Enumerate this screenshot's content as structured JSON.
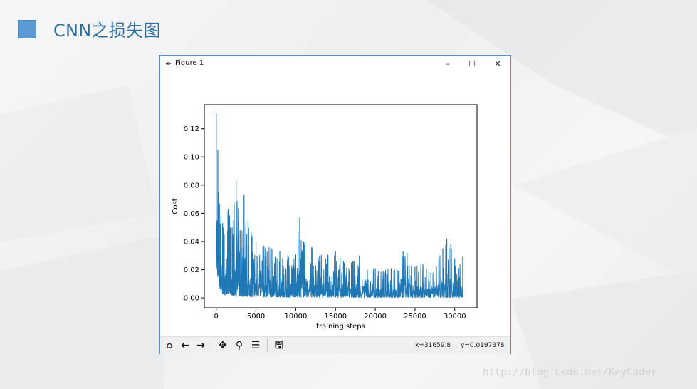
{
  "slide": {
    "title": "CNN之损失图"
  },
  "window": {
    "title": "Figure 1",
    "icon": "feather-icon",
    "controls": {
      "minimize": "–",
      "maximize": "☐",
      "close": "✕"
    }
  },
  "toolbar": {
    "buttons": [
      "home-icon",
      "back-arrow-icon",
      "forward-arrow-icon",
      "pan-icon",
      "zoom-icon",
      "configure-subplots-icon",
      "save-icon"
    ],
    "x_readout": "x=31659.8",
    "y_readout": "y=0.0197378"
  },
  "watermark": "http://blog.csdn.net/KeyCoder",
  "chart_data": {
    "type": "line",
    "xlabel": "training steps",
    "ylabel": "Cost",
    "xlim": [
      -1500,
      32800
    ],
    "ylim": [
      -0.007,
      0.137
    ],
    "xticks": [
      "0",
      "5000",
      "10000",
      "15000",
      "20000",
      "25000",
      "30000"
    ],
    "yticks": [
      "0.00",
      "0.02",
      "0.04",
      "0.06",
      "0.08",
      "0.10",
      "0.12"
    ],
    "series_color": "#1f77b4",
    "series": [
      {
        "x": [
          0,
          200,
          400,
          600,
          800,
          1000,
          1500,
          2000,
          2500,
          3000,
          3500,
          4000,
          4500,
          5000,
          6000,
          7000,
          8000,
          9000,
          10000,
          10500,
          11000,
          12000,
          13000,
          14000,
          15000,
          16000,
          17000,
          18000,
          19000,
          20000,
          21000,
          22000,
          23000,
          23500,
          24000,
          25000,
          26000,
          27000,
          28000,
          28500,
          29000,
          29500,
          30000,
          30500,
          31000
        ],
        "upper": [
          0.131,
          0.105,
          0.067,
          0.058,
          0.053,
          0.045,
          0.063,
          0.05,
          0.083,
          0.048,
          0.073,
          0.055,
          0.044,
          0.04,
          0.037,
          0.035,
          0.033,
          0.03,
          0.031,
          0.057,
          0.04,
          0.036,
          0.03,
          0.031,
          0.033,
          0.026,
          0.025,
          0.03,
          0.02,
          0.021,
          0.019,
          0.021,
          0.019,
          0.033,
          0.032,
          0.022,
          0.024,
          0.018,
          0.028,
          0.035,
          0.042,
          0.038,
          0.028,
          0.021,
          0.029
        ],
        "lower": [
          0.02,
          0.015,
          0.008,
          0.004,
          0.003,
          0.002,
          0.003,
          0.002,
          0.001,
          0.001,
          0.001,
          0.001,
          0.0008,
          0.0008,
          0.0007,
          0.0006,
          0.0006,
          0.0005,
          0.0005,
          0.0005,
          0.0005,
          0.0004,
          0.0004,
          0.0004,
          0.0004,
          0.0004,
          0.0004,
          0.0003,
          0.0003,
          0.0003,
          0.0003,
          0.0003,
          0.0003,
          0.0003,
          0.0003,
          0.0003,
          0.0003,
          0.0003,
          0.0003,
          0.0003,
          0.0003,
          0.0003,
          0.0003,
          0.0003,
          0.0003
        ]
      }
    ]
  }
}
